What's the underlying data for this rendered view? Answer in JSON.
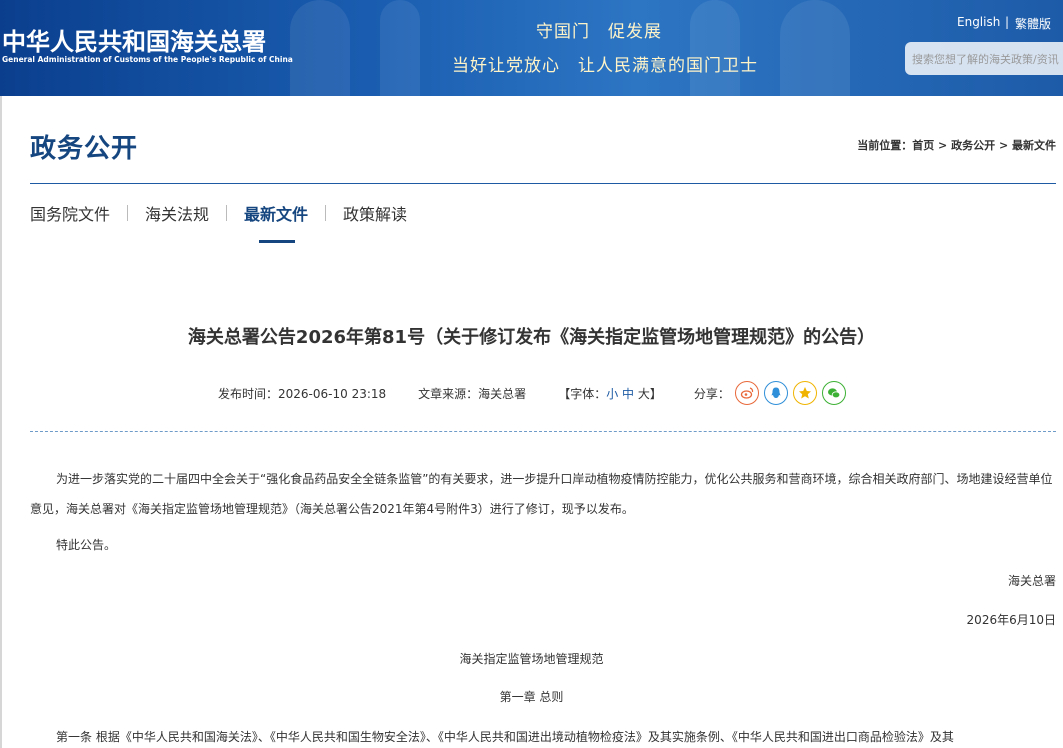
{
  "header": {
    "logo_cn": "中华人民共和国海关总署",
    "logo_en": "General Administration of Customs of the People's Republic of China",
    "slogan_line1": "守国门　促发展",
    "slogan_line2": "当好让党放心　让人民满意的国门卫士",
    "lang_english": "English",
    "lang_separator": "|",
    "lang_traditional": "繁體版",
    "search_placeholder": "搜索您想了解的海关政策/资讯"
  },
  "section": {
    "title": "政务公开",
    "breadcrumb_label": "当前位置：",
    "breadcrumb_home": "首页",
    "breadcrumb_sep": " > ",
    "breadcrumb_section": "政务公开",
    "breadcrumb_current": "最新文件"
  },
  "tabs": [
    {
      "label": "国务院文件",
      "active": false
    },
    {
      "label": "海关法规",
      "active": false
    },
    {
      "label": "最新文件",
      "active": true
    },
    {
      "label": "政策解读",
      "active": false
    }
  ],
  "article": {
    "title": "海关总署公告2026年第81号（关于修订发布《海关指定监管场地管理规范》的公告）",
    "publish_time_label": "发布时间：",
    "publish_time": "2026-06-10 23:18",
    "source_label": "文章来源：",
    "source": "海关总署",
    "font_label_open": "【字体：",
    "font_small": "小",
    "font_medium": "中",
    "font_large": "大",
    "font_label_close": "】",
    "share_label": "分享：",
    "share_icons": [
      "weibo-icon",
      "qq-icon",
      "qzone-icon",
      "wechat-icon"
    ],
    "paragraph1": "为进一步落实党的二十届四中全会关于“强化食品药品安全全链条监管”的有关要求，进一步提升口岸动植物疫情防控能力，优化公共服务和营商环境，综合相关政府部门、场地建设经营单位意见，海关总署对《海关指定监管场地管理规范》（海关总署公告2021年第4号附件3）进行了修订，现予以发布。",
    "paragraph2": "特此公告。",
    "signature_org": "海关总署",
    "signature_date": "2026年6月10日",
    "doc_title": "海关指定监管场地管理规范",
    "chapter1": "第一章 总则",
    "article1": "第一条 根据《中华人民共和国海关法》、《中华人民共和国生物安全法》、《中华人民共和国进出境动植物检疫法》及其实施条例、《中华人民共和国进出口商品检验法》及其"
  },
  "colors": {
    "brand_blue": "#16467f",
    "header_blue": "#1a5db0",
    "slogan_gold": "#fff4c8"
  }
}
